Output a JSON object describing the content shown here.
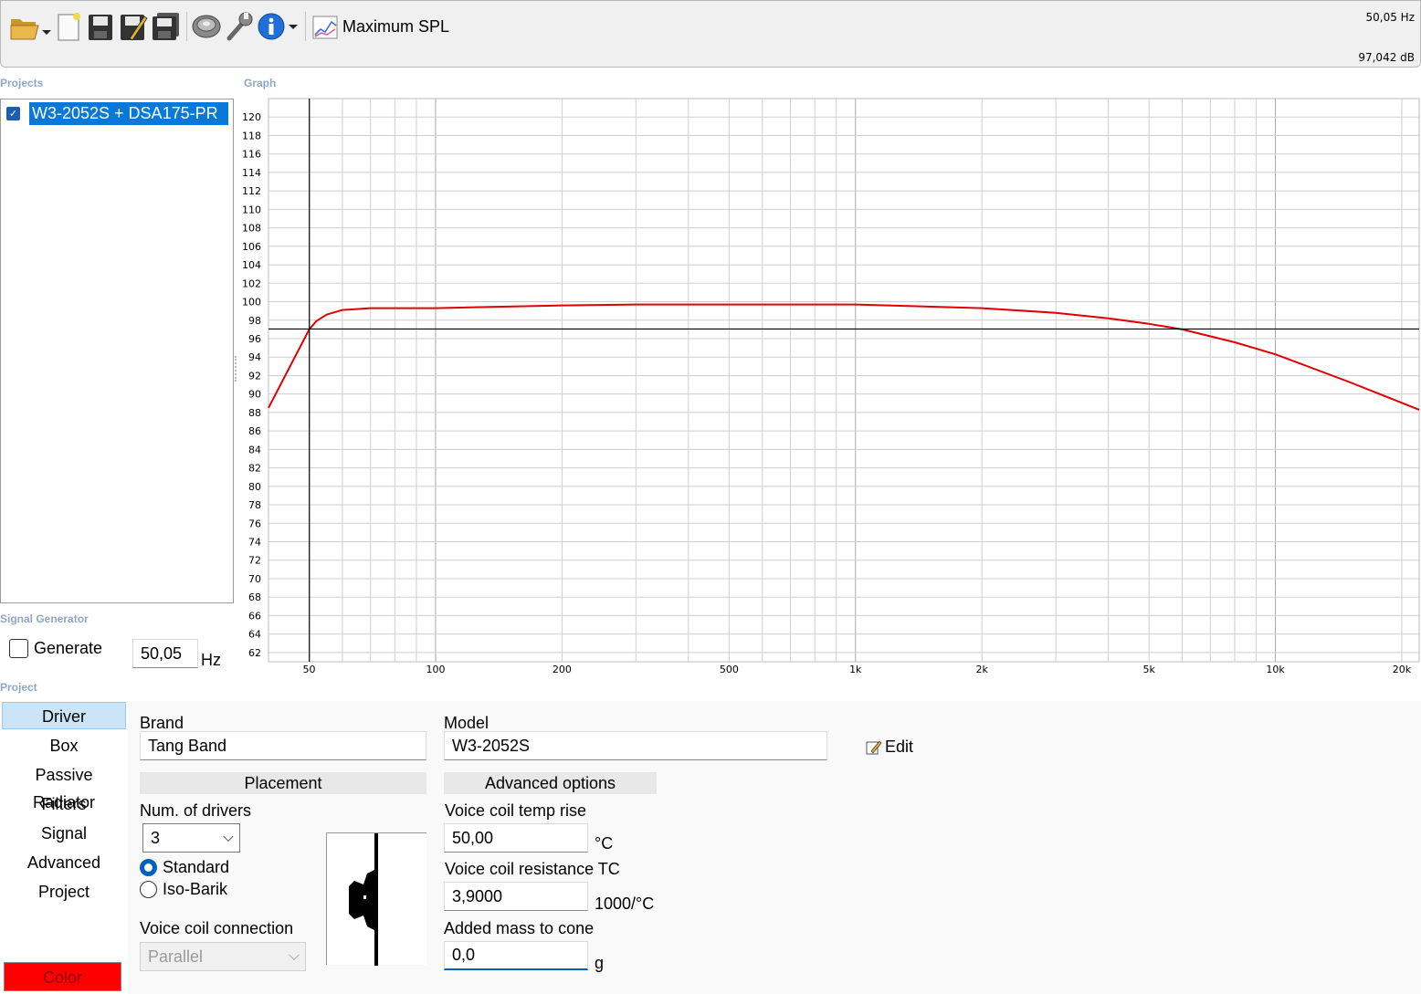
{
  "toolbar": {
    "graph_mode_label": "Maximum SPL",
    "readout_freq": "50,05 Hz",
    "readout_spl": "97,042 dB",
    "icons": [
      "open-folder-icon",
      "new-document-icon",
      "save-icon",
      "save-as-icon",
      "save-all-icon",
      "speaker-icon",
      "wrench-icon",
      "info-icon",
      "chart-icon"
    ]
  },
  "sections": {
    "projects": "Projects",
    "graph": "Graph",
    "signal_generator": "Signal Generator",
    "project": "Project"
  },
  "projects": {
    "items": [
      {
        "label": "W3-2052S + DSA175-PR",
        "checked": true
      }
    ]
  },
  "signal_generator": {
    "generate_label": "Generate",
    "frequency_value": "50,05",
    "unit": "Hz"
  },
  "chart_data": {
    "type": "line",
    "x_scale": "log",
    "xlim": [
      40,
      22000
    ],
    "ylim": [
      61,
      122
    ],
    "x_tick_labels": [
      {
        "v": 50,
        "t": "50"
      },
      {
        "v": 100,
        "t": "100"
      },
      {
        "v": 200,
        "t": "200"
      },
      {
        "v": 500,
        "t": "500"
      },
      {
        "v": 1000,
        "t": "1k"
      },
      {
        "v": 2000,
        "t": "2k"
      },
      {
        "v": 5000,
        "t": "5k"
      },
      {
        "v": 10000,
        "t": "10k"
      },
      {
        "v": 20000,
        "t": "20k"
      }
    ],
    "y_ticks": [
      62,
      64,
      66,
      68,
      70,
      72,
      74,
      76,
      78,
      80,
      82,
      84,
      86,
      88,
      90,
      92,
      94,
      96,
      98,
      100,
      102,
      104,
      106,
      108,
      110,
      112,
      114,
      116,
      118,
      120
    ],
    "grid": true,
    "cursor": {
      "x": 50.05,
      "y": 97.042
    },
    "series": [
      {
        "color": "#e00000",
        "x": [
          40,
          50,
          52,
          55,
          60,
          70,
          100,
          200,
          300,
          500,
          1000,
          2000,
          3000,
          4000,
          5000,
          6000,
          8000,
          10000,
          15000,
          22000
        ],
        "y": [
          88.5,
          97.0,
          97.9,
          98.6,
          99.1,
          99.3,
          99.3,
          99.6,
          99.7,
          99.7,
          99.7,
          99.3,
          98.8,
          98.2,
          97.6,
          97.0,
          95.6,
          94.3,
          91.3,
          88.3
        ]
      }
    ]
  },
  "project": {
    "nav": [
      "Driver",
      "Box",
      "Passive Radiator",
      "Filters",
      "Signal",
      "Advanced",
      "Project"
    ],
    "active_nav": 0,
    "color_label": "Color",
    "color_value": "#ff0000"
  },
  "driver": {
    "brand_label": "Brand",
    "brand_value": "Tang Band",
    "model_label": "Model",
    "model_value": "W3-2052S",
    "edit_label": "Edit",
    "placement_header": "Placement",
    "num_drivers_label": "Num. of drivers",
    "num_drivers_value": "3",
    "placement_options": [
      {
        "label": "Standard",
        "selected": true
      },
      {
        "label": "Iso-Barik",
        "selected": false
      }
    ],
    "voice_coil_connection_label": "Voice coil connection",
    "voice_coil_connection_value": "Parallel",
    "advanced_header": "Advanced options",
    "vc_temp_rise_label": "Voice coil temp rise",
    "vc_temp_rise_value": "50,00",
    "vc_temp_rise_unit": "°C",
    "vc_resistance_tc_label": "Voice coil resistance TC",
    "vc_resistance_tc_value": "3,9000",
    "vc_resistance_tc_unit": "1000/°C",
    "added_mass_label": "Added mass to cone",
    "added_mass_value": "0,0",
    "added_mass_unit": "g"
  }
}
